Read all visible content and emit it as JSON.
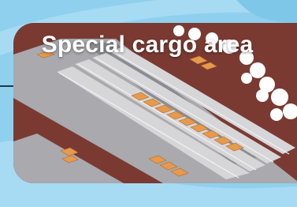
{
  "card": {
    "title": "Special cargo area"
  },
  "colors": {
    "background": "#8fd0ee",
    "ground": "#7a3a32",
    "road": "#a9a9ae",
    "track_bed": "#d6d6d9",
    "rail": "#f2f2f4",
    "train_car": "#e59a4c",
    "tree": "#ffffff"
  }
}
